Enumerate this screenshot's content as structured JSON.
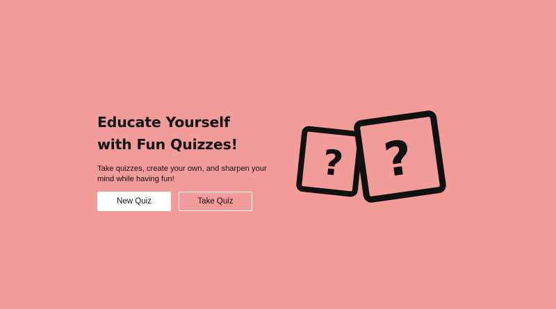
{
  "hero": {
    "title": "Educate Yourself with Fun Quizzes!",
    "subtitle": "Take quizzes, create your own, and sharpen your mind while having fun!"
  },
  "buttons": {
    "new_quiz_label": "New Quiz",
    "take_quiz_label": "Take Quiz"
  },
  "illustration": {
    "icon": "question-mark-cards-icon",
    "glyph": "?"
  },
  "colors": {
    "background": "#f29c99",
    "text": "#111111",
    "button_fill": "#ffffff",
    "button_border": "#ffffff"
  }
}
